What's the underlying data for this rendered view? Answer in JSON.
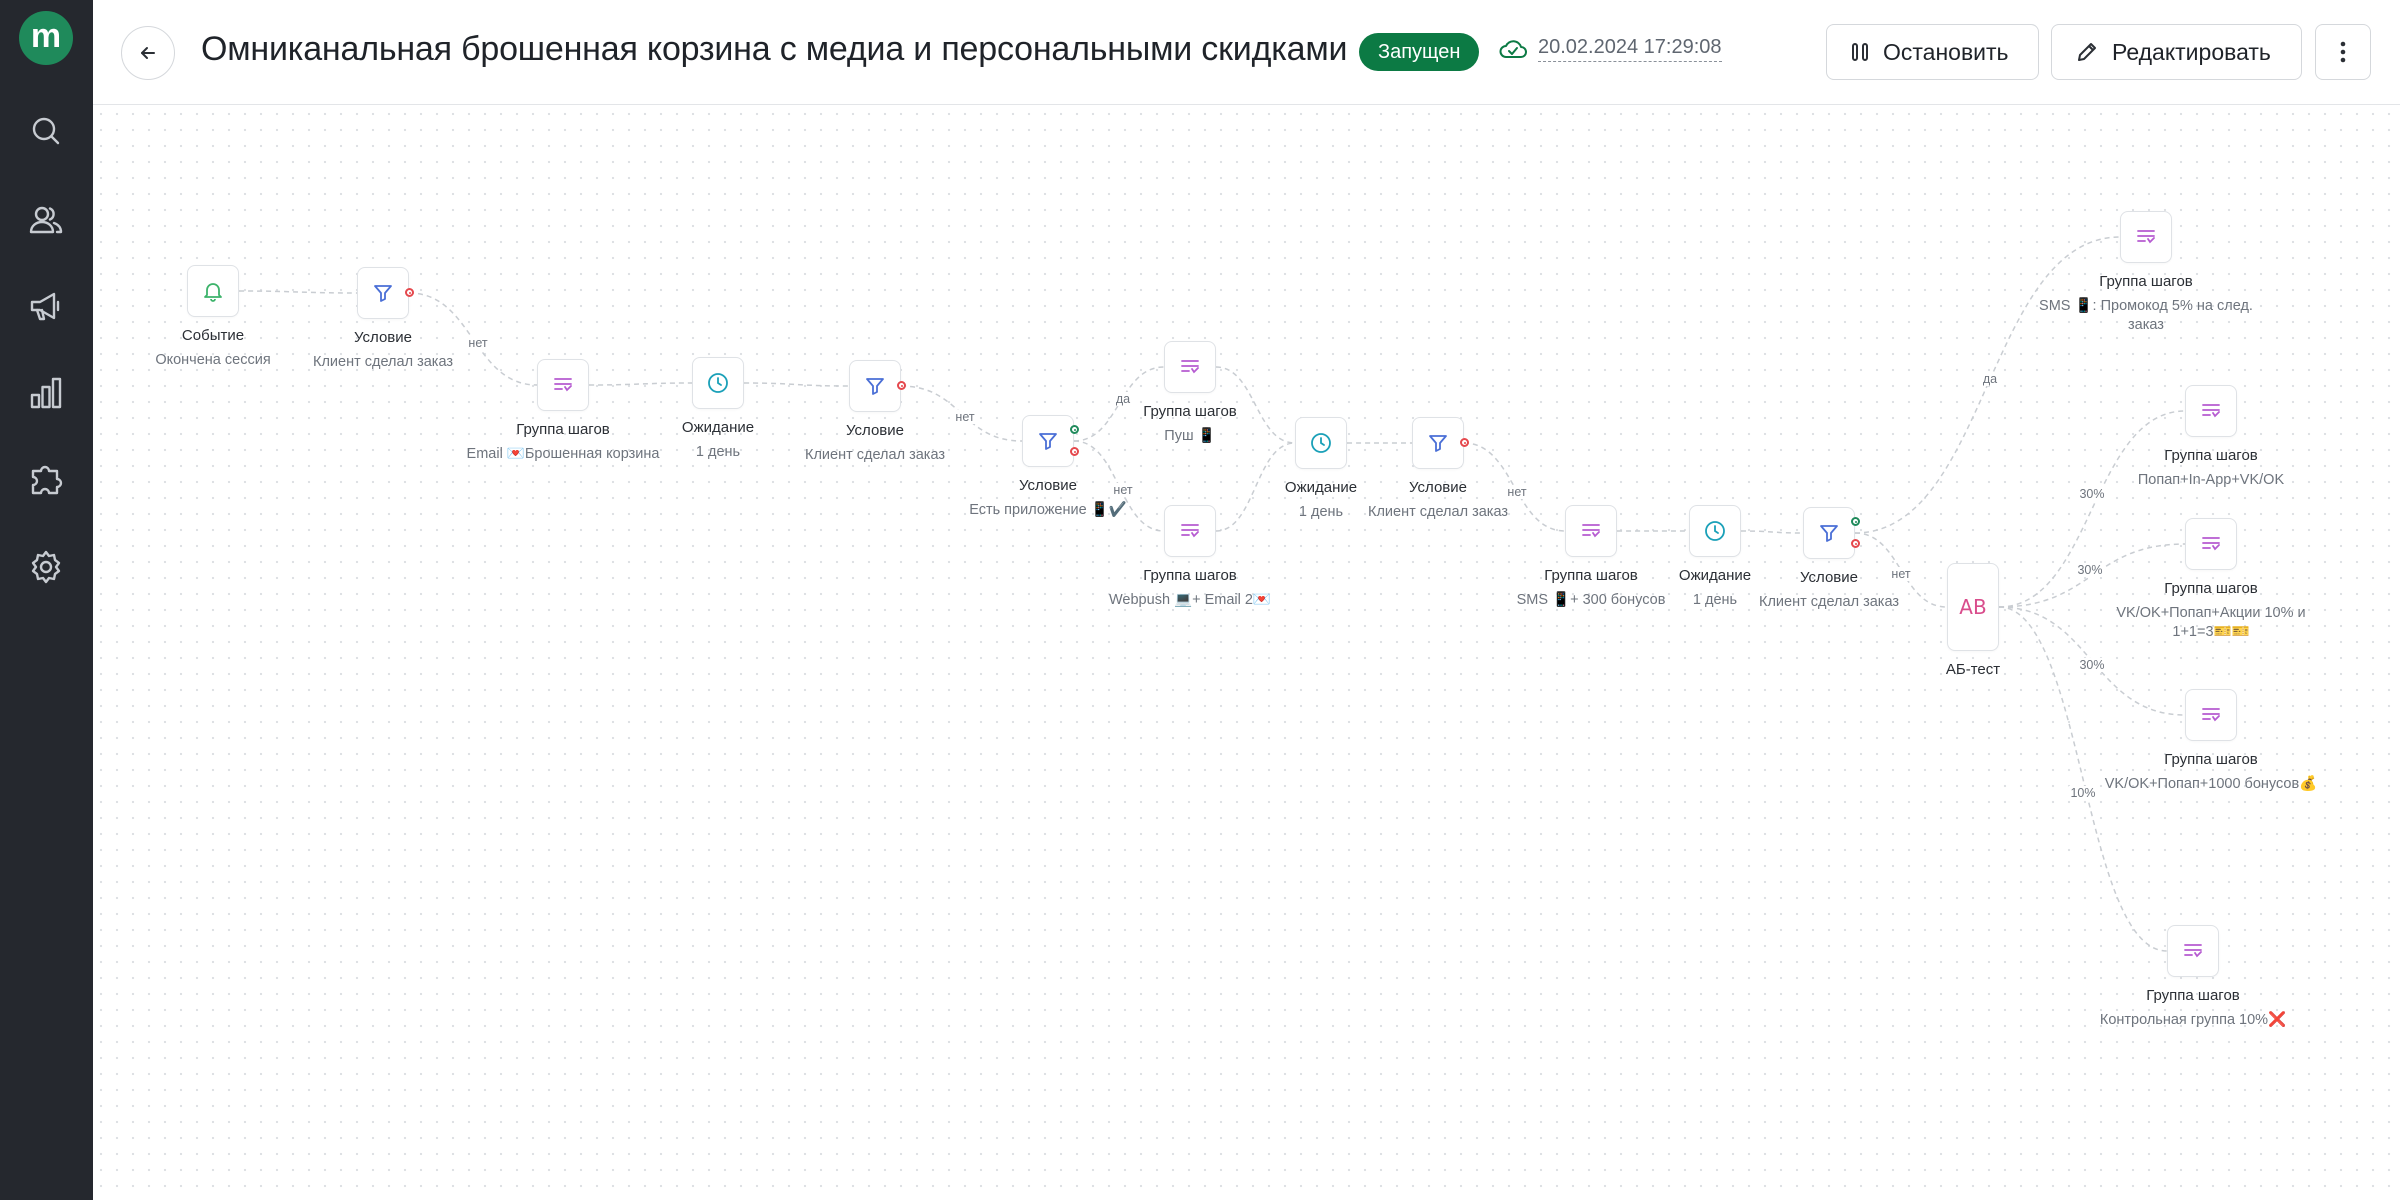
{
  "header": {
    "title": "Омниканальная брошенная корзина с медиа и персональными скидками",
    "status": "Запущен",
    "saved_at": "20.02.2024 17:29:08",
    "stop_label": "Остановить",
    "edit_label": "Редактировать"
  },
  "sidebar": {
    "logo": "m",
    "items": [
      {
        "icon": "search-icon"
      },
      {
        "icon": "users-icon"
      },
      {
        "icon": "megaphone-icon"
      },
      {
        "icon": "bar-chart-icon"
      },
      {
        "icon": "puzzle-icon"
      },
      {
        "icon": "gear-icon"
      }
    ]
  },
  "flow": {
    "nodes": [
      {
        "type": "event",
        "title": "Событие",
        "subtitle": "Окончена сессия"
      },
      {
        "type": "condition",
        "title": "Условие",
        "subtitle": "Клиент сделал заказ"
      },
      {
        "type": "group",
        "title": "Группа шагов",
        "subtitle": "Email 💌Брошенная корзина"
      },
      {
        "type": "wait",
        "title": "Ожидание",
        "subtitle": "1 день"
      },
      {
        "type": "condition",
        "title": "Условие",
        "subtitle": "Клиент сделал заказ"
      },
      {
        "type": "condition",
        "title": "Условие",
        "subtitle": "Есть приложение 📱✔️"
      },
      {
        "type": "group",
        "title": "Группа шагов",
        "subtitle": "Пуш 📱"
      },
      {
        "type": "group",
        "title": "Группа шагов",
        "subtitle": "Webpush 💻+ Email 2💌"
      },
      {
        "type": "wait",
        "title": "Ожидание",
        "subtitle": "1 день"
      },
      {
        "type": "condition",
        "title": "Условие",
        "subtitle": "Клиент сделал заказ"
      },
      {
        "type": "group",
        "title": "Группа шагов",
        "subtitle": "SMS 📱+ 300 бонусов"
      },
      {
        "type": "wait",
        "title": "Ожидание",
        "subtitle": "1 день"
      },
      {
        "type": "condition",
        "title": "Условие",
        "subtitle": "Клиент сделал заказ"
      },
      {
        "type": "ab",
        "title": "АБ-тест",
        "subtitle": "",
        "icon_text": "AB"
      },
      {
        "type": "group",
        "title": "Группа шагов",
        "subtitle": "SMS 📱: Промокод 5% на след. заказ"
      },
      {
        "type": "group",
        "title": "Группа шагов",
        "subtitle": "Попап+In-App+VK/OK"
      },
      {
        "type": "group",
        "title": "Группа шагов",
        "subtitle": "VK/OK+Попап+Акции 10% и 1+1=3🎫🎫"
      },
      {
        "type": "group",
        "title": "Группа шагов",
        "subtitle": "VK/OK+Попап+1000 бонусов💰"
      },
      {
        "type": "group",
        "title": "Группа шагов",
        "subtitle": "Контрольная группа 10%❌"
      }
    ],
    "edges": [
      {
        "from": 0,
        "to": 1,
        "label": ""
      },
      {
        "from": 1,
        "to": 2,
        "label": "нет"
      },
      {
        "from": 2,
        "to": 3,
        "label": ""
      },
      {
        "from": 3,
        "to": 4,
        "label": ""
      },
      {
        "from": 4,
        "to": 5,
        "label": "нет"
      },
      {
        "from": 5,
        "to": 6,
        "label": "да"
      },
      {
        "from": 5,
        "to": 7,
        "label": "нет"
      },
      {
        "from": 6,
        "to": 8,
        "label": ""
      },
      {
        "from": 7,
        "to": 8,
        "label": ""
      },
      {
        "from": 8,
        "to": 9,
        "label": ""
      },
      {
        "from": 9,
        "to": 10,
        "label": "нет"
      },
      {
        "from": 10,
        "to": 11,
        "label": ""
      },
      {
        "from": 11,
        "to": 12,
        "label": ""
      },
      {
        "from": 12,
        "to": 14,
        "label": "да"
      },
      {
        "from": 12,
        "to": 13,
        "label": "нет"
      },
      {
        "from": 13,
        "to": 15,
        "label": "30%"
      },
      {
        "from": 13,
        "to": 16,
        "label": "30%"
      },
      {
        "from": 13,
        "to": 17,
        "label": "30%"
      },
      {
        "from": 13,
        "to": 18,
        "label": "10%"
      }
    ]
  },
  "colors": {
    "accent_green": "#0c7a44",
    "sidebar_bg": "#25282e",
    "condition_icon": "#4a6fd6",
    "wait_icon": "#1aa0b8",
    "group_icon": "#b65bd1",
    "event_icon": "#3db36b",
    "ab_icon": "#d94d8c"
  }
}
